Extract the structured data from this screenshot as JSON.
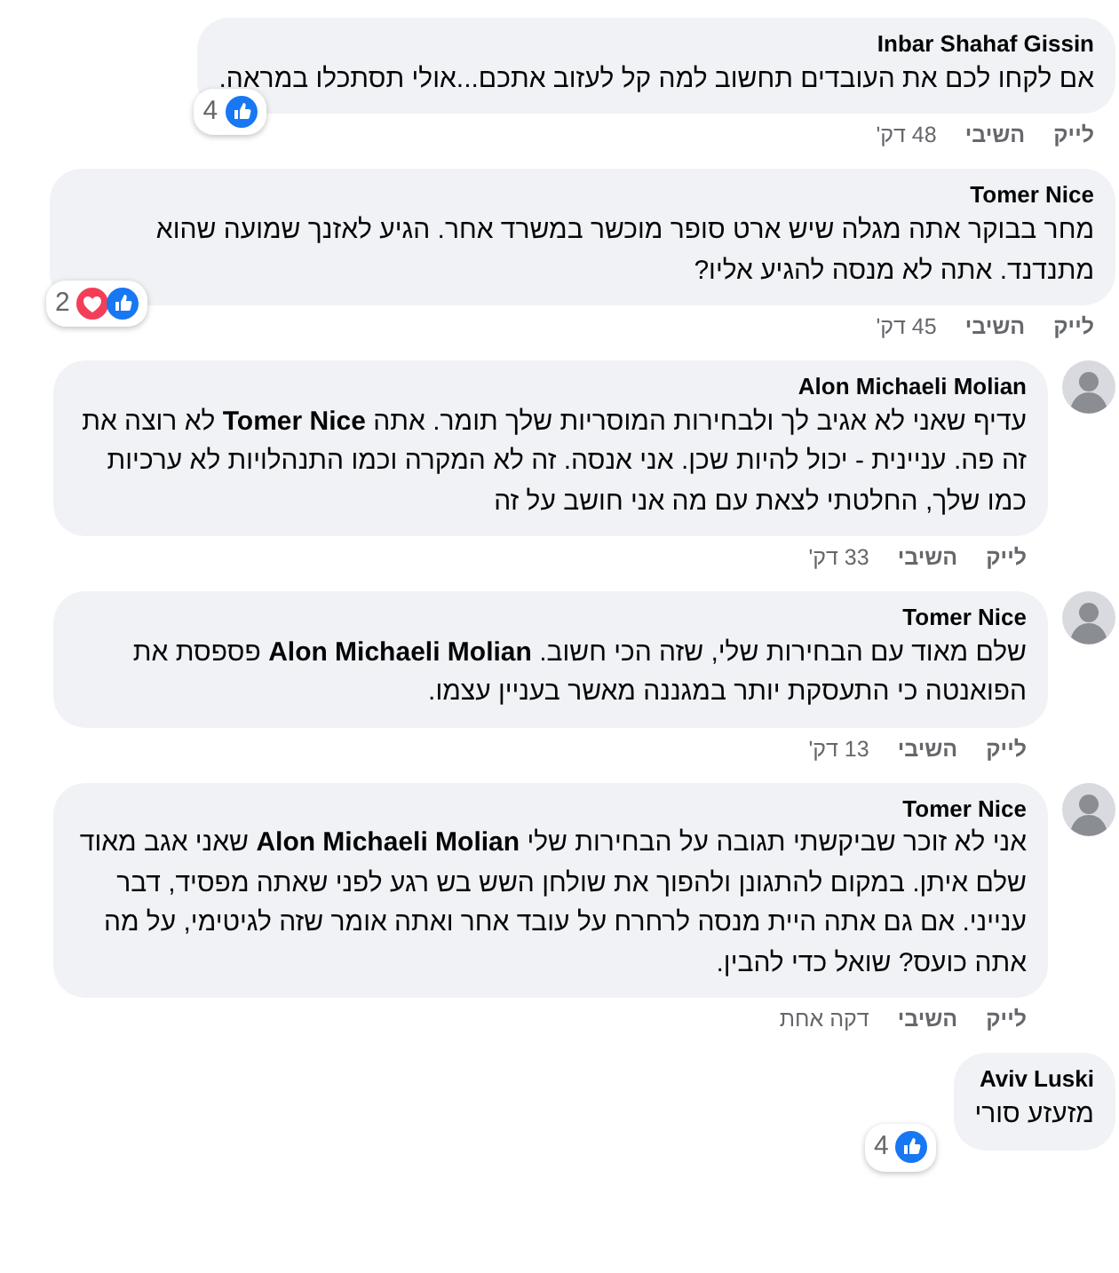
{
  "comments": [
    {
      "author": "Inbar Shahaf Gissin",
      "avatar": false,
      "text": "אם לקחו לכם את העובדים תחשוב למה קל לעזוב אתכם...אולי תסתכלו במראה.",
      "reactions": [
        {
          "kind": "like"
        }
      ],
      "reaction_count": "4",
      "actions": [
        "לייק",
        "השיבי"
      ],
      "time": "48 דק'"
    },
    {
      "author": "Tomer Nice",
      "avatar": false,
      "text": "מחר בבוקר אתה מגלה שיש ארט סופר מוכשר במשרד אחר. הגיע לאזנך שמועה שהוא מתנדנד. אתה לא מנסה להגיע אליו?",
      "reactions": [
        {
          "kind": "like"
        },
        {
          "kind": "love"
        }
      ],
      "reaction_count": "2",
      "actions": [
        "לייק",
        "השיבי"
      ],
      "time": "45 דק'"
    },
    {
      "author": "Alon Michaeli Molian",
      "avatar": true,
      "text": "עדיף שאני לא אגיב לך ולבחירות המוסריות שלך תומר. אתה **Tomer Nice** לא רוצה את זה פה. עניינית - יכול להיות שכן. אני אנסה. זה לא המקרה וכמו התנהלויות לא ערכיות כמו שלך, החלטתי לצאת עם מה אני חושב על זה",
      "actions": [
        "לייק",
        "השיבי"
      ],
      "time": "33 דק'"
    },
    {
      "author": "Tomer Nice",
      "avatar": true,
      "text": "שלם מאוד עם הבחירות שלי, שזה הכי חשוב. **Alon Michaeli Molian** פספסת את הפואנטה כי התעסקת יותר במגננה מאשר בעניין עצמו.",
      "actions": [
        "לייק",
        "השיבי"
      ],
      "time": "13 דק'"
    },
    {
      "author": "Tomer Nice",
      "avatar": true,
      "text": "אני לא זוכר שביקשתי תגובה על הבחירות שלי **Alon Michaeli Molian** שאני אגב מאוד שלם איתן. במקום להתגונן ולהפוך את שולחן השש בש רגע לפני שאתה מפסיד, דבר ענייני. אם גם אתה היית מנסה לרחרח על עובד אחר ואתה אומר שזה לגיטימי, על מה אתה כועס? שואל כדי להבין.",
      "actions": [
        "לייק",
        "השיבי"
      ],
      "time": "דקה אחת"
    },
    {
      "author": "Aviv Luski",
      "avatar": false,
      "text": "מזעזע סורי",
      "reactions": [
        {
          "kind": "like"
        }
      ],
      "reaction_count": "4"
    }
  ]
}
